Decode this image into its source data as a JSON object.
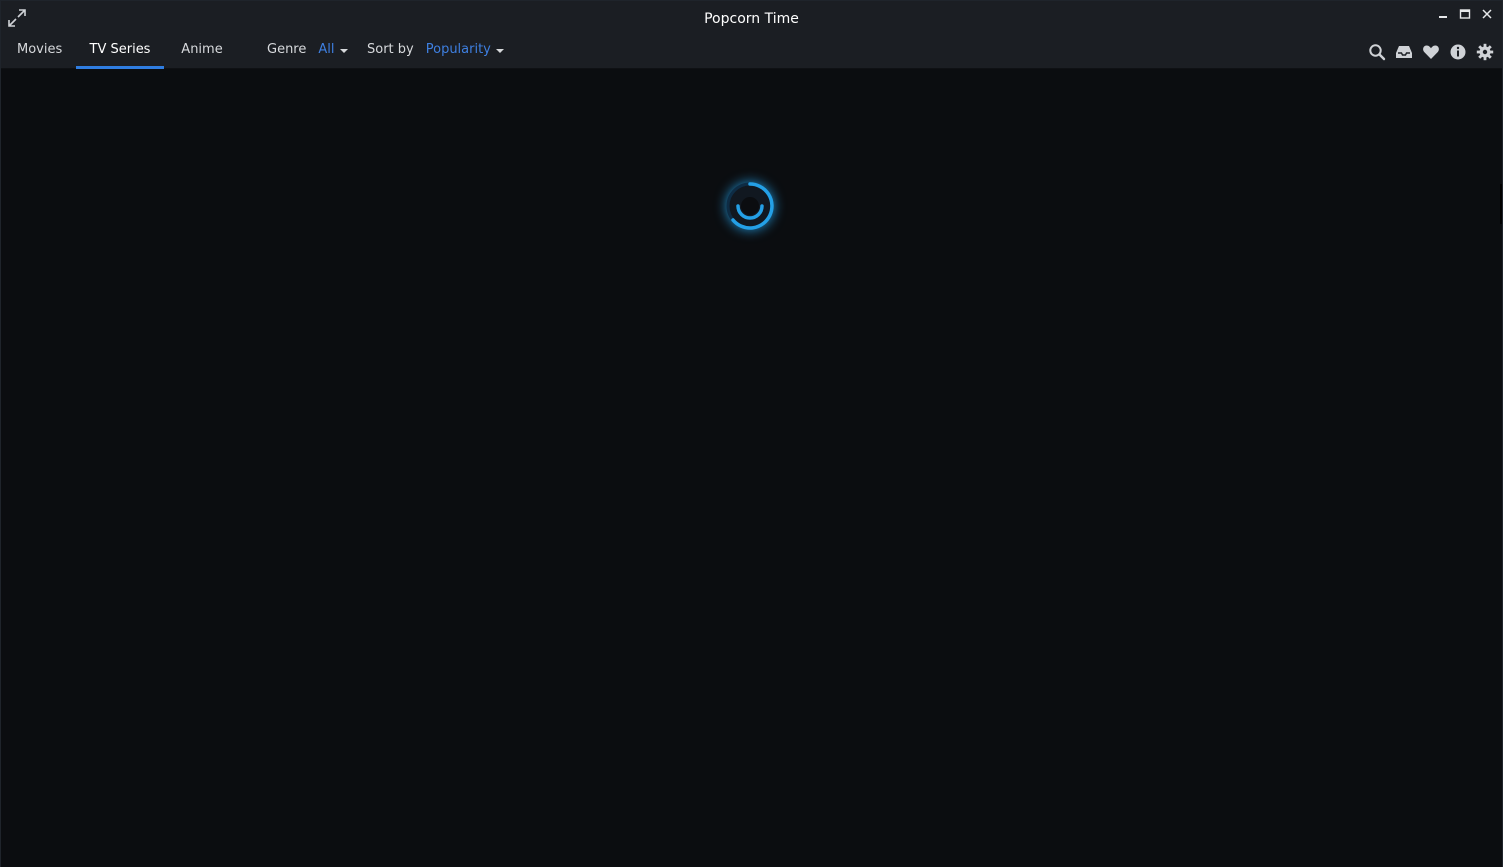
{
  "window": {
    "title": "Popcorn Time"
  },
  "nav": {
    "tabs": [
      {
        "label": "Movies",
        "active": false
      },
      {
        "label": "TV Series",
        "active": true
      },
      {
        "label": "Anime",
        "active": false
      }
    ],
    "genre": {
      "label": "Genre",
      "value": "All"
    },
    "sort": {
      "label": "Sort by",
      "value": "Popularity"
    }
  },
  "icons": {
    "expand": "expand-icon",
    "minimize": "minimize-icon",
    "maximize": "maximize-icon",
    "close": "close-icon",
    "search": "search-icon",
    "inbox": "inbox-icon",
    "favorites": "heart-icon",
    "about": "info-icon",
    "settings": "gear-icon"
  },
  "colors": {
    "accent": "#2f7de1",
    "spinner": "#24a0e6",
    "background": "#0b0d10",
    "bar": "#1b1e23"
  },
  "content": {
    "state": "loading"
  }
}
